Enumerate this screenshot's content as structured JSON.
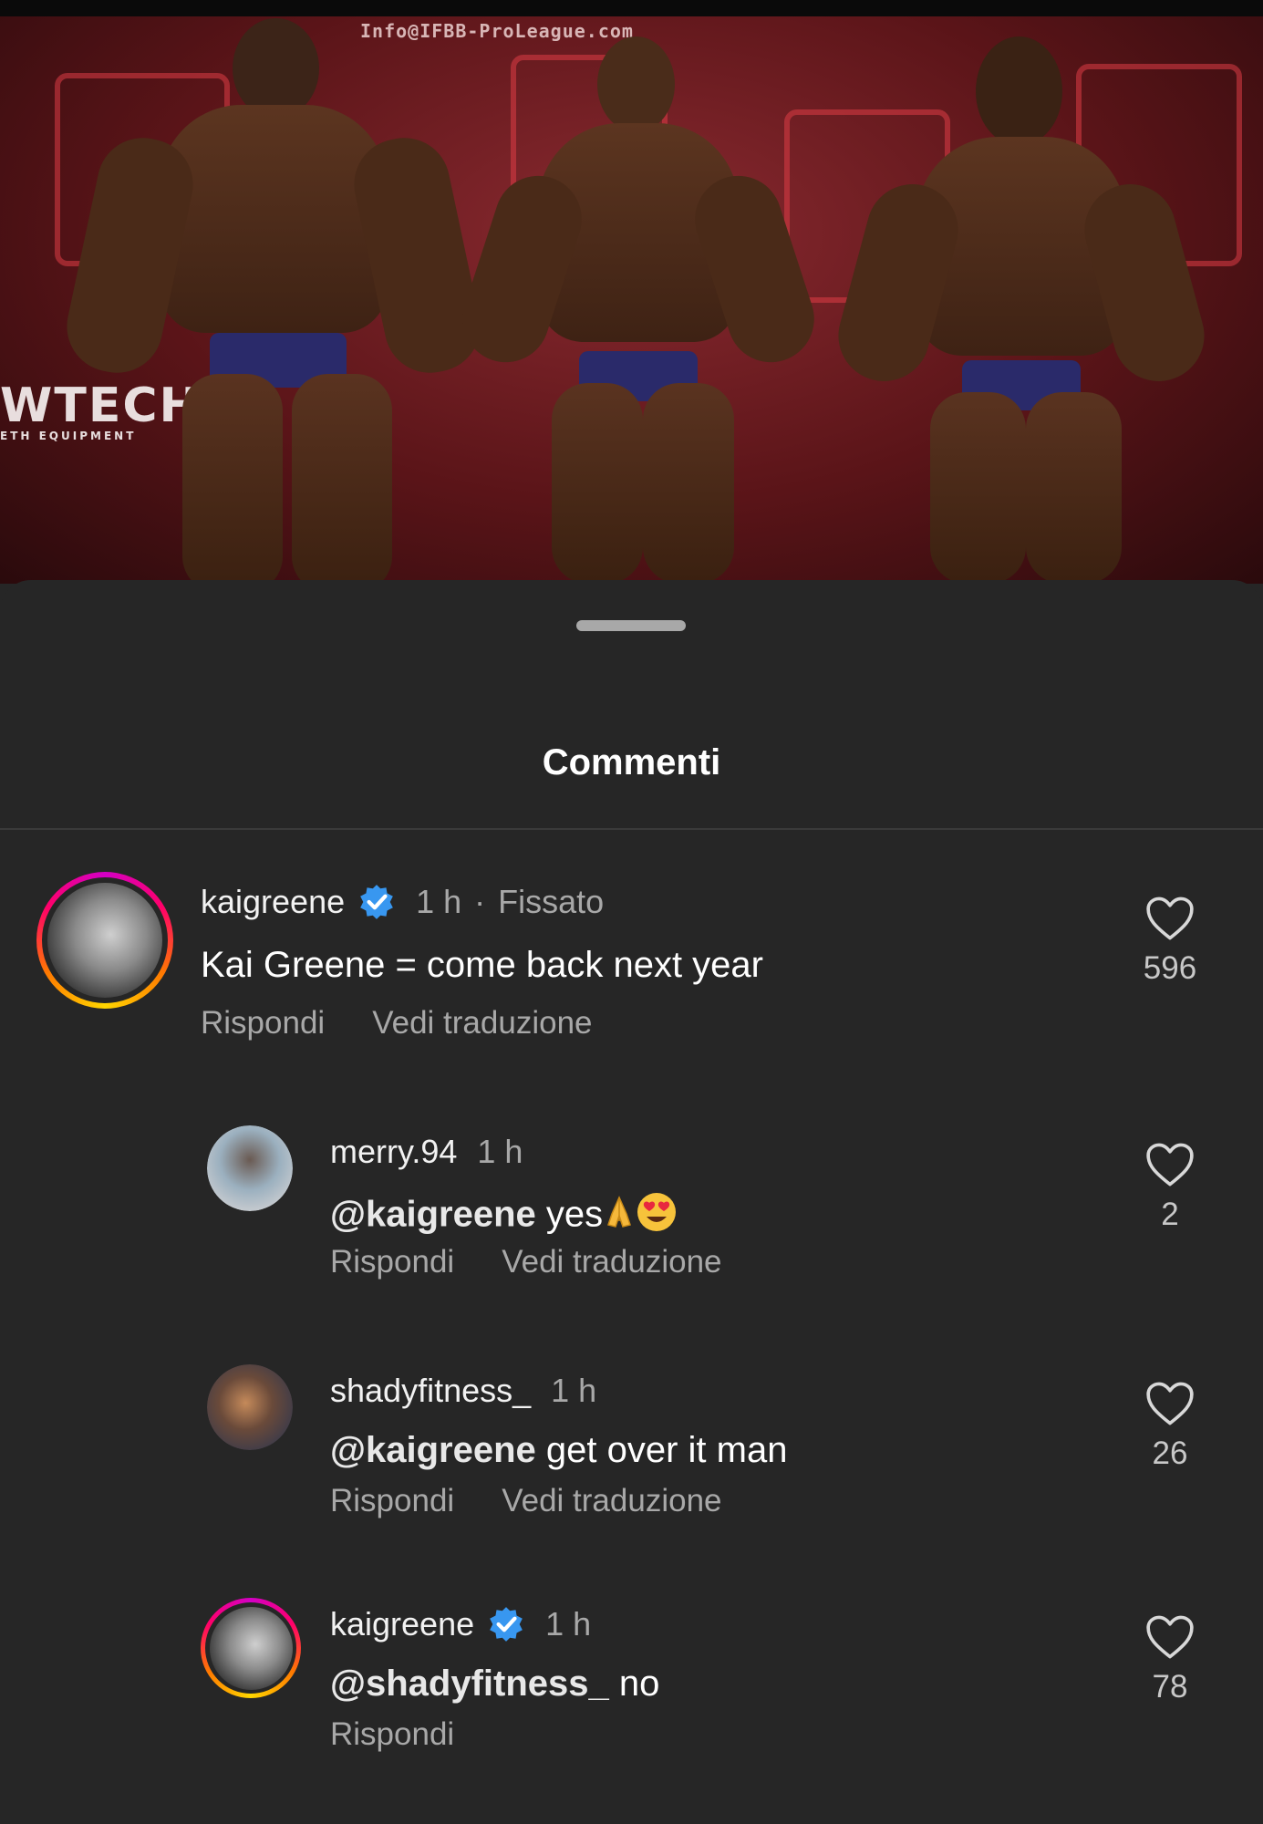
{
  "hero": {
    "watermark": "Info@IFBB-ProLeague.com",
    "brand_left": "WTECH",
    "brand_left_sub": "ETH EQUIPMENT"
  },
  "sheet": {
    "title": "Commenti"
  },
  "comments": [
    {
      "username": "kaigreene",
      "verified": true,
      "time": "1 h",
      "pinned_label": "Fissato",
      "mention": "",
      "text": "Kai Greene = come back next year",
      "reply_label": "Rispondi",
      "translate_label": "Vedi traduzione",
      "likes": "596"
    },
    {
      "username": "merry.94",
      "verified": false,
      "time": "1 h",
      "mention": "@kaigreene",
      "text": "yes",
      "reply_label": "Rispondi",
      "translate_label": "Vedi traduzione",
      "likes": "2"
    },
    {
      "username": "shadyfitness_",
      "verified": false,
      "time": "1 h",
      "mention": "@kaigreene",
      "text": " get over it man",
      "reply_label": "Rispondi",
      "translate_label": "Vedi traduzione",
      "likes": "26"
    },
    {
      "username": "kaigreene",
      "verified": true,
      "time": "1 h",
      "mention": "@shadyfitness_",
      "text": " no",
      "reply_label": "Rispondi",
      "likes": "78"
    }
  ],
  "colors": {
    "accent_verified": "#3897f0",
    "muted": "#a8a8a8",
    "background": "#262626"
  }
}
